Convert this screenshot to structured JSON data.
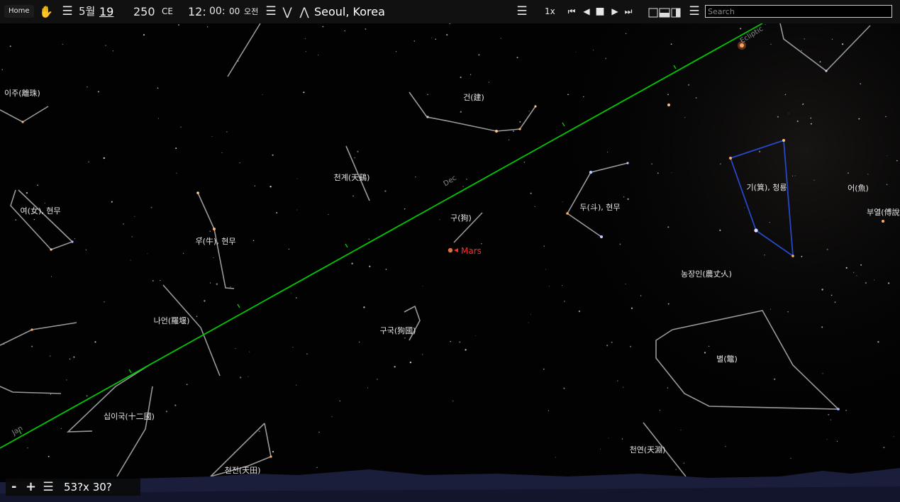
{
  "toolbar": {
    "home_label": "Home",
    "month": "5월",
    "day": "19",
    "year": "250",
    "era": "CE",
    "hour": "12:",
    "minute": "00:",
    "second": "00",
    "ampm": "오전",
    "location": "Seoul, Korea",
    "speed": "1x",
    "search_placeholder": "Search",
    "icons": [
      "hand-icon",
      "menu-icon",
      "chevron-down-icon",
      "chevron-up-icon",
      "skip-back-icon",
      "play-back-icon",
      "stop-icon",
      "play-icon",
      "skip-forward-icon",
      "view-mode-icon"
    ]
  },
  "zoom": {
    "minus": "-",
    "plus": "+",
    "fov": "53?x 30?"
  },
  "ecliptic_labels": {
    "top": "Ecliptic",
    "dec": "Dec",
    "jan": "Jan"
  },
  "planet": {
    "name": "Mars",
    "color": "#ff2a2a"
  },
  "constellations": [
    "이주(離珠)",
    "건(建)",
    "천계(天鷄)",
    "여(女), 현무",
    "우(牛), 현무",
    "구(狗)",
    "두(斗), 현무",
    "기(箕), 청룡",
    "어(魚)",
    "부열(傅說",
    "농장인(農丈人)",
    "나언(羅堰)",
    "구국(狗國)",
    "별(鼈)",
    "십이국(十二國)",
    "천전(天田)",
    "천연(天淵)"
  ],
  "colors": {
    "ecliptic": "#00c800",
    "constellation_lines": "#9a9a9a",
    "highlight_lines": "#2040c0",
    "toolbar_bg": "#121212"
  }
}
